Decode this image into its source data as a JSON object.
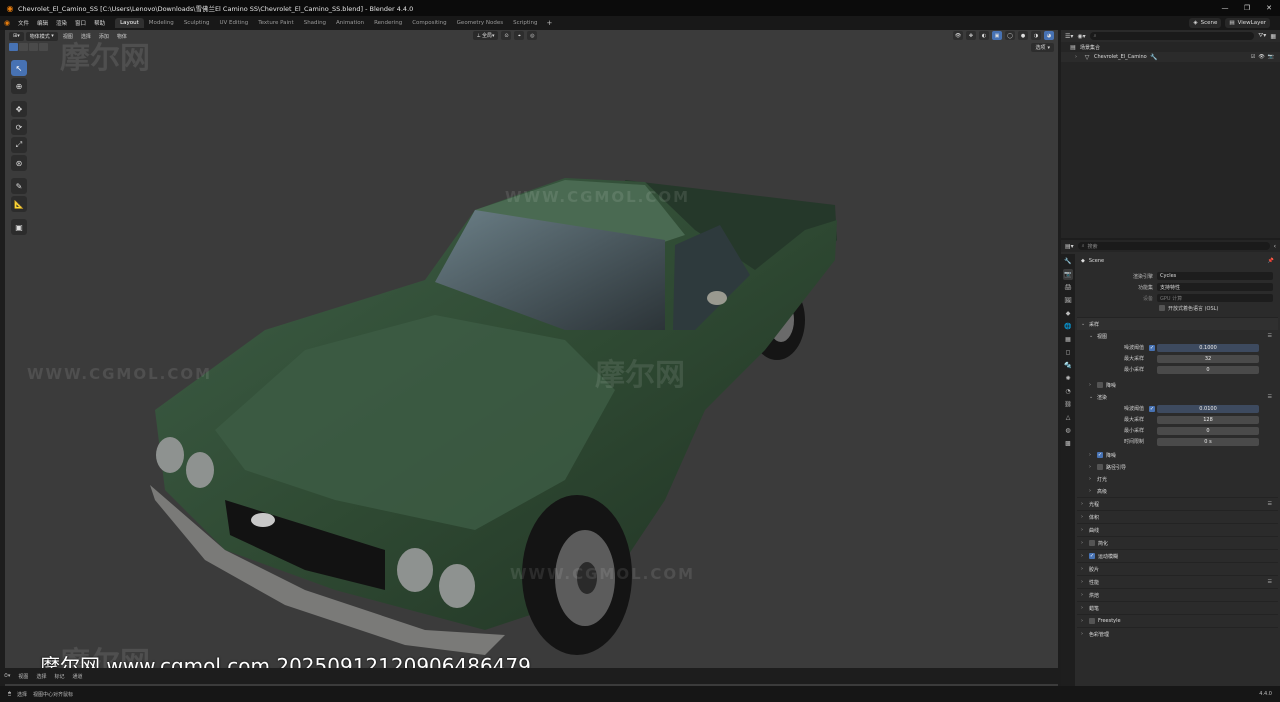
{
  "window": {
    "title": "Chevrolet_El_Camino_SS [C:\\Users\\Lenovo\\Downloads\\雪佛兰El Camino SS\\Chevrolet_El_Camino_SS.blend] - Blender 4.4.0"
  },
  "menu": [
    "文件",
    "编辑",
    "渲染",
    "窗口",
    "帮助"
  ],
  "workspaces": [
    "Layout",
    "Modeling",
    "Sculpting",
    "UV Editing",
    "Texture Paint",
    "Shading",
    "Animation",
    "Rendering",
    "Compositing",
    "Geometry Nodes",
    "Scripting"
  ],
  "active_workspace": "Layout",
  "topbar_right": {
    "scene": "Scene",
    "view_layer": "ViewLayer"
  },
  "viewport": {
    "mode": "物体模式",
    "menus": [
      "视图",
      "选择",
      "添加",
      "物体"
    ],
    "transform_orientation": "全局",
    "options_label": "选项"
  },
  "watermarks": {
    "cn": "摩尔网",
    "url": "WWW.CGMOL.COM",
    "overlay": "摩尔网 www.cgmol.com 20250912120906486479"
  },
  "viewport_footer": {
    "select": "选择",
    "menus": [
      "视图",
      "选择",
      "标记",
      "通道"
    ],
    "marker": "标记"
  },
  "statusbar": {
    "select": "选择",
    "center": "视图中心对齐鼠标",
    "version": "4.4.0"
  },
  "outliner": {
    "search_placeholder": "",
    "rows": [
      {
        "label": "场景集合",
        "indent": 0
      },
      {
        "label": "Chevrolet_El_Camino",
        "indent": 1
      }
    ]
  },
  "properties": {
    "search_placeholder": "搜索",
    "scene_name": "Scene",
    "render_engine_label": "渲染引擎",
    "render_engine": "Cycles",
    "feature_set_label": "功能集",
    "feature_set": "支持特性",
    "device_label": "设备",
    "device": "GPU 计算",
    "osl_label": "开放式着色语言 (OSL)",
    "sampling": "采样",
    "viewport_section": "视图",
    "viewport_rows": [
      {
        "label": "噪波阈值",
        "value": "0.1000",
        "check": true
      },
      {
        "label": "最大采样",
        "value": "32",
        "check": false
      },
      {
        "label": "最小采样",
        "value": "0",
        "check": false
      }
    ],
    "denoise_vp": "降噪",
    "render_section": "渲染",
    "render_rows": [
      {
        "label": "噪波阈值",
        "value": "0.0100",
        "check": true
      },
      {
        "label": "最大采样",
        "value": "128",
        "check": false
      },
      {
        "label": "最小采样",
        "value": "0",
        "check": false
      },
      {
        "label": "时间限制",
        "value": "0 s",
        "check": false
      }
    ],
    "render_sub": [
      {
        "label": "降噪",
        "check": true
      },
      {
        "label": "路径引导",
        "check": false
      },
      {
        "label": "灯光",
        "check": null
      },
      {
        "label": "高级",
        "check": null
      }
    ],
    "panels": [
      {
        "label": "光程",
        "check": null,
        "list": true
      },
      {
        "label": "体积",
        "check": null,
        "list": false
      },
      {
        "label": "曲线",
        "check": null,
        "list": false
      },
      {
        "label": "简化",
        "check": false,
        "list": false
      },
      {
        "label": "运动模糊",
        "check": true,
        "list": false
      },
      {
        "label": "胶片",
        "check": null,
        "list": false
      },
      {
        "label": "性能",
        "check": null,
        "list": true
      },
      {
        "label": "烘焙",
        "check": null,
        "list": false
      },
      {
        "label": "蜡笔",
        "check": null,
        "list": false
      },
      {
        "label": "Freestyle",
        "check": false,
        "list": false
      },
      {
        "label": "色彩管理",
        "check": null,
        "list": false
      }
    ]
  },
  "colors": {
    "accent": "#4772b3",
    "viewport_bg": "#3b3b3b",
    "car_body": "#2f4a33"
  }
}
